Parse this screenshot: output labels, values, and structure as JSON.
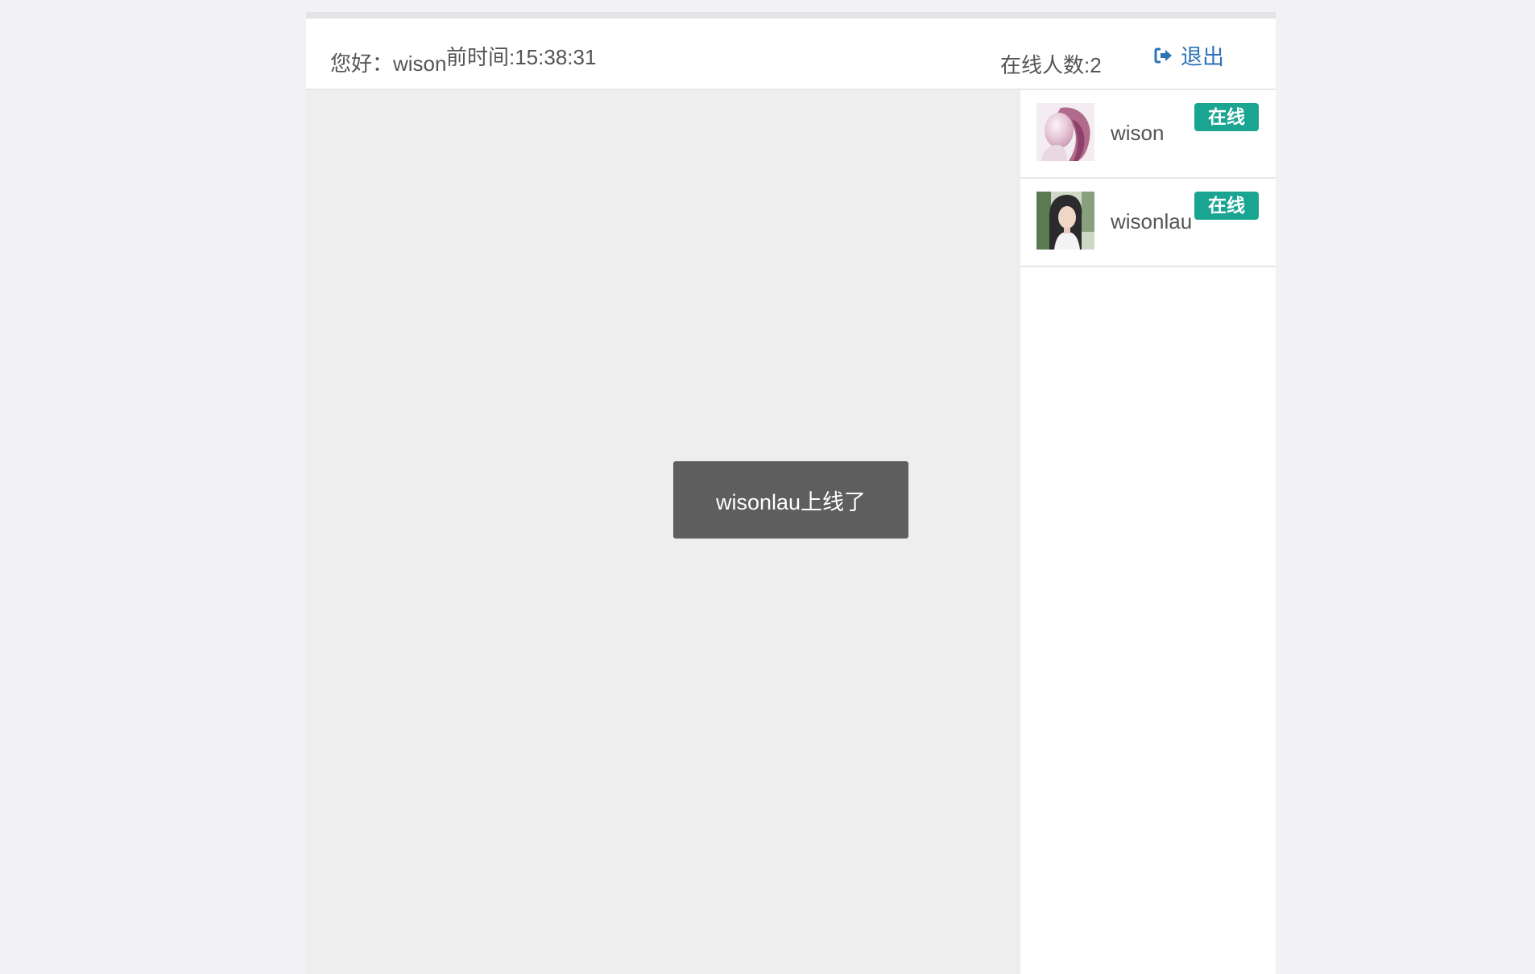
{
  "header": {
    "greeting": "您好：wison",
    "clock": "前时间:15:38:31",
    "online_count": "在线人数:2",
    "logout_label": "退出",
    "logout_icon": "sign-out-icon",
    "accent_color": "#2d73b8"
  },
  "toast": {
    "message": "wisonlau上线了"
  },
  "users": [
    {
      "name": "wison",
      "status": "在线",
      "avatar": "avatar-pink-hair"
    },
    {
      "name": "wisonlau",
      "status": "在线",
      "avatar": "avatar-girl-portrait"
    }
  ],
  "colors": {
    "badge_online": "#1aa592",
    "toast_bg": "#5e5e5e",
    "chat_bg": "#eeeeee"
  }
}
